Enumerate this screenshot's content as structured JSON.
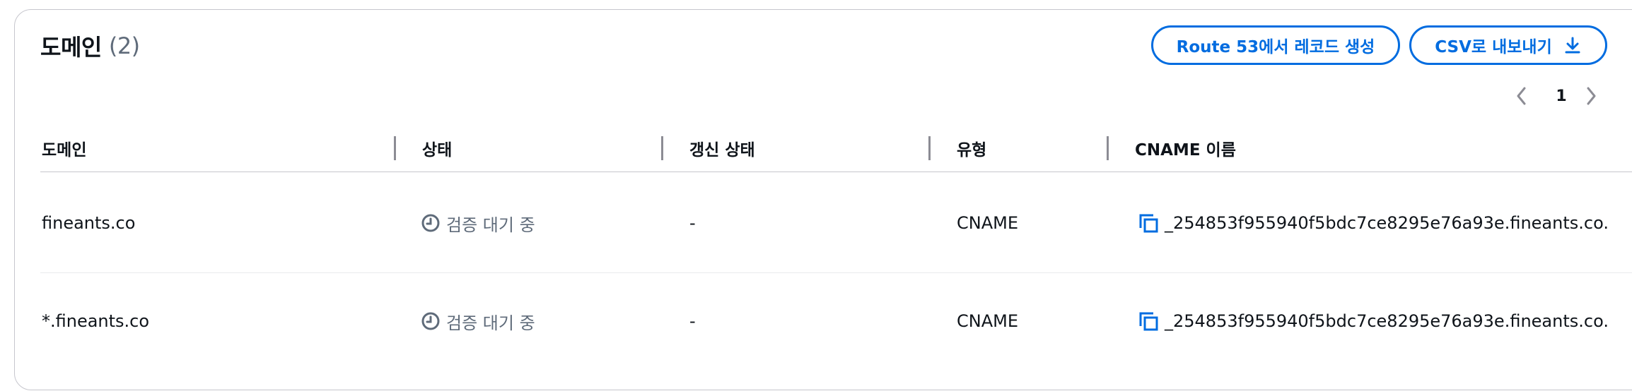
{
  "header": {
    "title": "도메인",
    "count": "(2)"
  },
  "actions": {
    "route53_label": "Route 53에서 레코드 생성",
    "csv_label": "CSV로 내보내기",
    "csv_icon": "download-icon"
  },
  "pagination": {
    "current_page": "1"
  },
  "table": {
    "columns": [
      "도메인",
      "상태",
      "갱신 상태",
      "유형",
      "CNAME 이름"
    ],
    "rows": [
      {
        "domain": "fineants.co",
        "status": "검증 대기 중",
        "renewal": "-",
        "type": "CNAME",
        "cname": "_254853f955940f5bdc7ce8295e76a93e.fineants.co."
      },
      {
        "domain": "*.fineants.co",
        "status": "검증 대기 중",
        "renewal": "-",
        "type": "CNAME",
        "cname": "_254853f955940f5bdc7ce8295e76a93e.fineants.co."
      }
    ]
  },
  "colors": {
    "accent": "#006ce0",
    "text": "#0f141a",
    "muted": "#5f6b7a",
    "border": "#c6c6cd"
  }
}
